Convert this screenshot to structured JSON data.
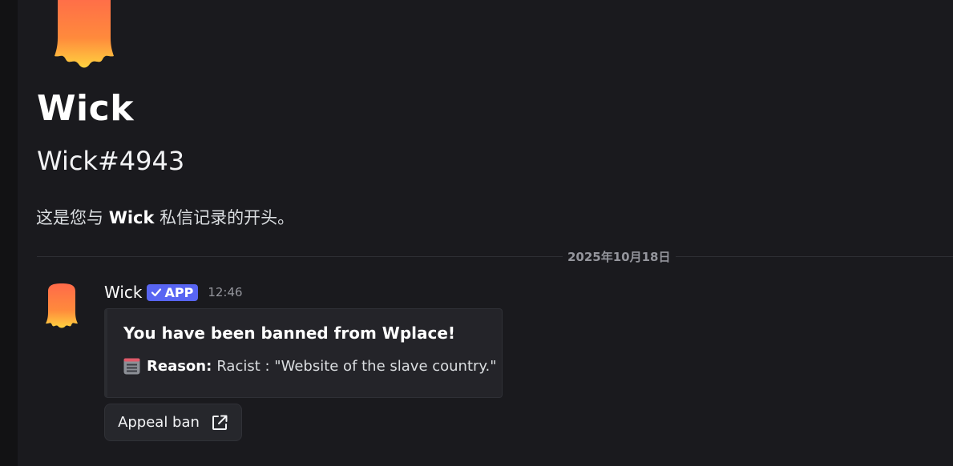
{
  "header": {
    "name": "Wick",
    "tag": "Wick#4943",
    "intro_prefix": "这是您与 ",
    "intro_name": "Wick",
    "intro_suffix": " 私信记录的开头。"
  },
  "divider": {
    "date": "2025年10月18日"
  },
  "message": {
    "author": "Wick",
    "badge": "APP",
    "timestamp": "12:46",
    "embed": {
      "title": "You have been banned from Wplace!",
      "field_label": "Reason:",
      "field_value": "Racist : \"Website of the slave country.\""
    },
    "button": {
      "label": "Appeal ban",
      "icon": "external-link-icon"
    }
  },
  "colors": {
    "background": "#1a1a1e",
    "badge": "#5865f2",
    "avatar_top": "#ff6a4a",
    "avatar_bottom": "#ffd23f"
  }
}
